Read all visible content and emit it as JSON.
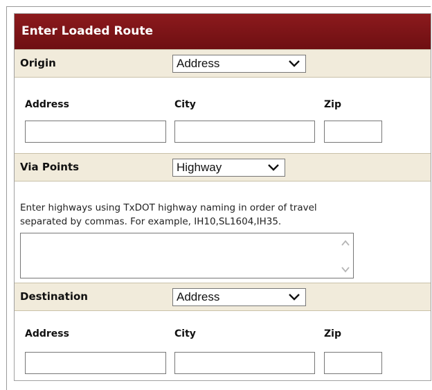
{
  "panel": {
    "title": "Enter Loaded Route"
  },
  "origin": {
    "label": "Origin",
    "type_select": "Address",
    "fields": {
      "address_label": "Address",
      "city_label": "City",
      "zip_label": "Zip"
    }
  },
  "via": {
    "label": "Via Points",
    "type_select": "Highway",
    "help_line1": "Enter highways using TxDOT highway naming in order of travel",
    "help_line2": "separated by commas. For example, IH10,SL1604,IH35."
  },
  "destination": {
    "label": "Destination",
    "type_select": "Address",
    "fields": {
      "address_label": "Address",
      "city_label": "City",
      "zip_label": "Zip"
    }
  }
}
